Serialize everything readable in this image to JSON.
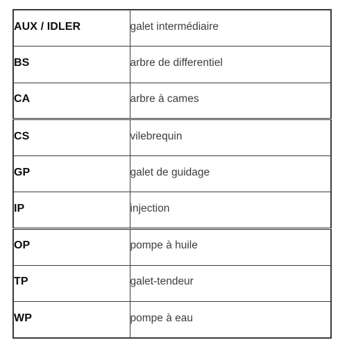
{
  "table": {
    "columns": [
      {
        "key": "abbr",
        "header": ""
      },
      {
        "key": "term",
        "header": ""
      }
    ],
    "rows": [
      {
        "abbr": "AUX / IDLER",
        "term": "galet intermédiaire",
        "group_end": false
      },
      {
        "abbr": "BS",
        "term": "arbre de differentiel",
        "group_end": false
      },
      {
        "abbr": "CA",
        "term": "arbre à cames",
        "group_end": true
      },
      {
        "abbr": "CS",
        "term": "vilebrequin",
        "group_end": false
      },
      {
        "abbr": "GP",
        "term": "galet de guidage",
        "group_end": false
      },
      {
        "abbr": "IP",
        "term": "injection",
        "group_end": true
      },
      {
        "abbr": "OP",
        "term": "pompe à huile",
        "group_end": false
      },
      {
        "abbr": "TP",
        "term": "galet-tendeur",
        "group_end": false
      },
      {
        "abbr": "WP",
        "term": "pompe à eau",
        "group_end": false
      }
    ]
  },
  "colors": {
    "border": "#3a3a3a",
    "group_separator": "#2b2b2b",
    "abbr_text": "#0d0d0d",
    "term_text": "#3d3d3d",
    "background": "#ffffff"
  }
}
